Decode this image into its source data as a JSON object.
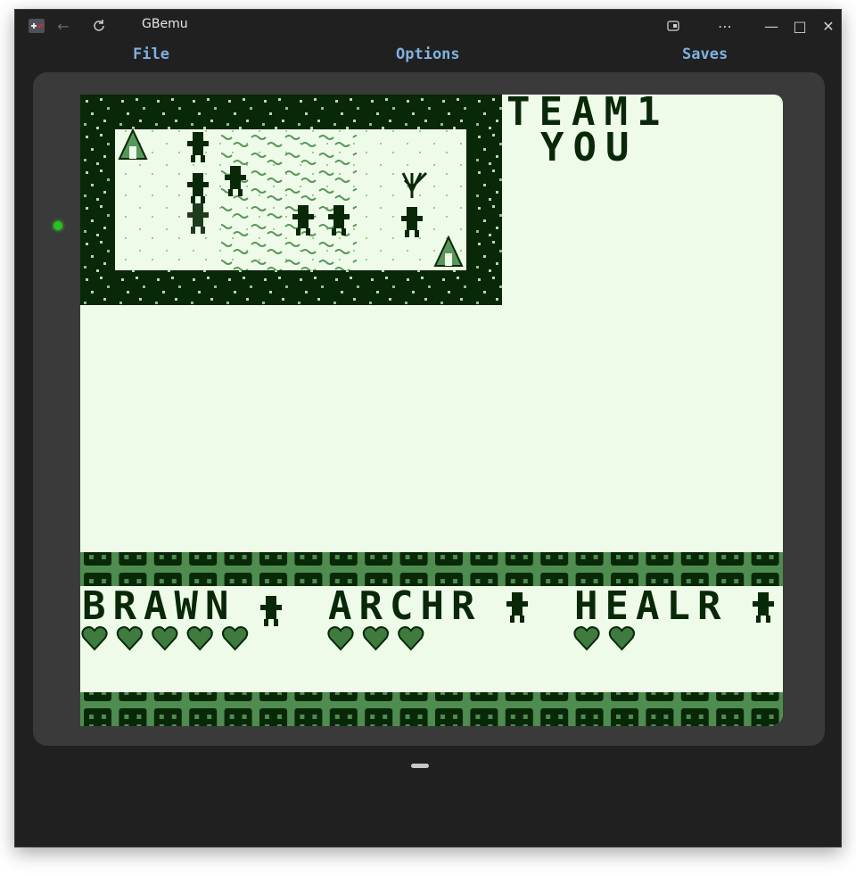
{
  "window": {
    "title": "GBemu",
    "controls": {
      "minimize": "—",
      "maximize": "□",
      "close": "✕"
    }
  },
  "menu": {
    "file": "File",
    "options": "Options",
    "saves": "Saves"
  },
  "colors": {
    "darkest": "#082808",
    "dark": "#2d5a2d",
    "mid": "#5a965a",
    "light": "#eefbe8",
    "led": "#26c21f",
    "menu_text": "#7fb0e0"
  },
  "game": {
    "team_label": "TEAM1",
    "player_label": "YOU",
    "units": [
      {
        "name": "BRAWN",
        "hearts": 5
      },
      {
        "name": "ARCHR",
        "hearts": 3
      },
      {
        "name": "HEALR",
        "hearts": 2
      }
    ]
  }
}
